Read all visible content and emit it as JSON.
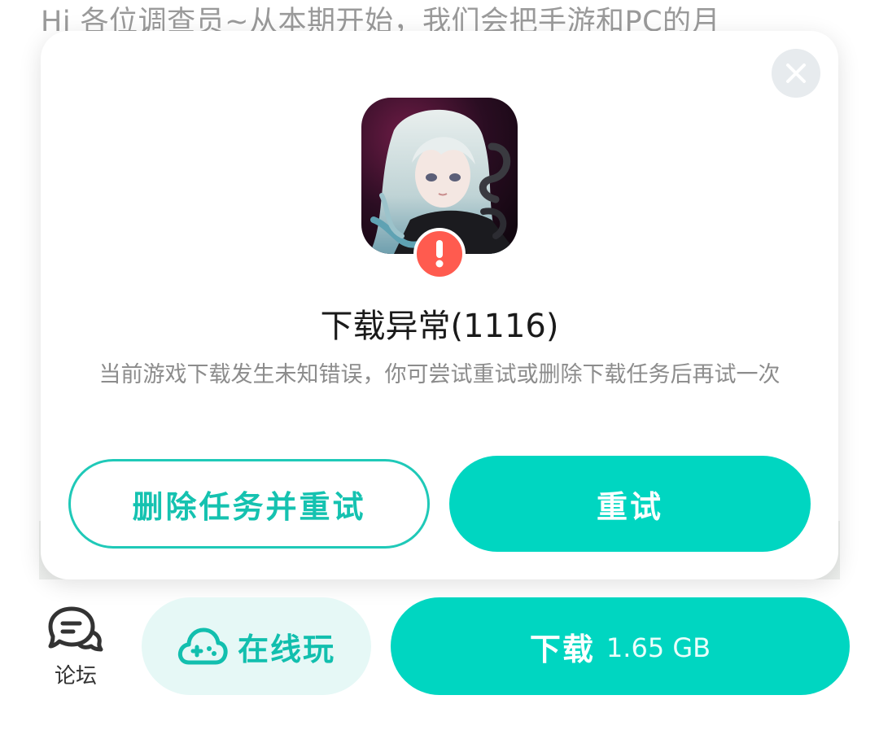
{
  "background": {
    "article_text": "Hi 各位调查员~从本期开始，我们会把手游和PC的月"
  },
  "dialog": {
    "title": "下载异常(1116)",
    "message": "当前游戏下载发生未知错误，你可尝试重试或删除下载任务后再试一次",
    "secondary_button": "删除任务并重试",
    "primary_button": "重试",
    "icons": {
      "close": "close-icon",
      "game": "game-app-icon",
      "badge": "error-exclamation-icon"
    }
  },
  "bottom_bar": {
    "forum_label": "论坛",
    "play_online_label": "在线玩",
    "download_label": "下载",
    "download_size": "1.65 GB",
    "icons": {
      "forum": "chat-bubble-icon",
      "play_online": "cloud-gamepad-icon"
    }
  },
  "colors": {
    "accent": "#00d6c1",
    "accent_text": "#15c2b0",
    "accent_light": "#e6f8f6",
    "error": "#ff5b4f"
  }
}
